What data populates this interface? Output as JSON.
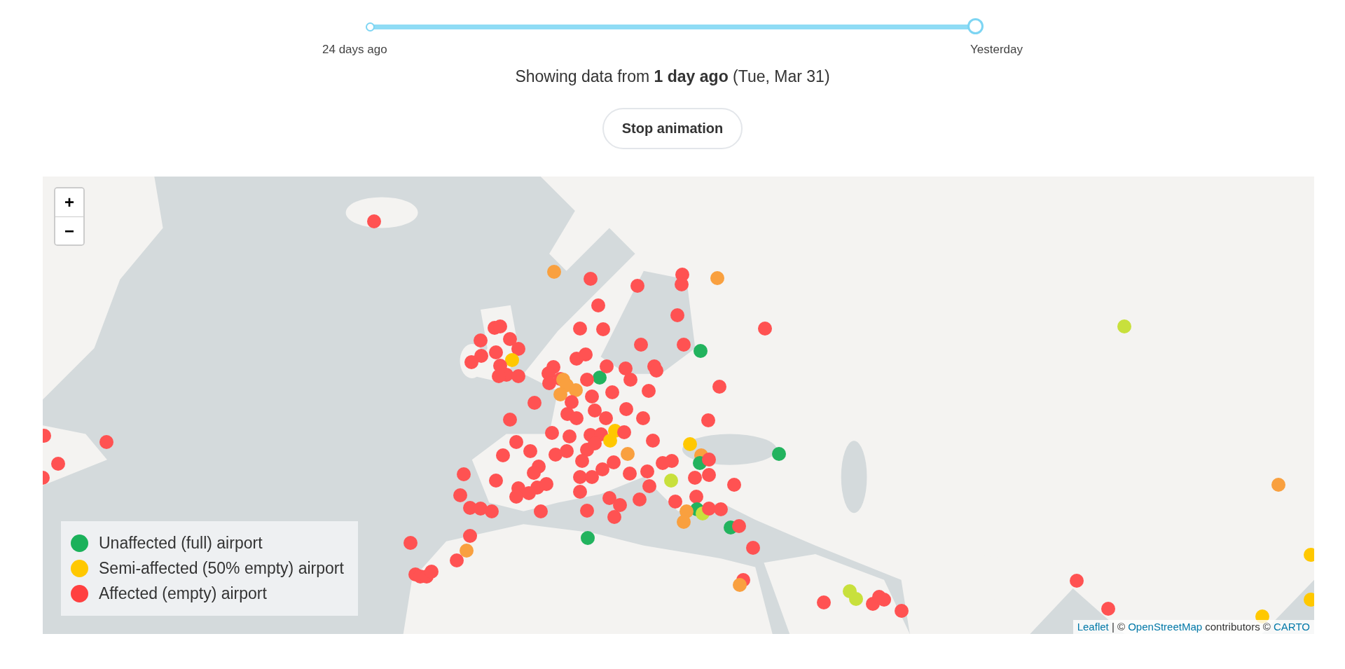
{
  "slider": {
    "start_label": "24 days ago",
    "end_label": "Yesterday",
    "level": 1
  },
  "status": "Showing data from **1 day ago** (Tue, Mar 31)",
  "animation_button": "Stop animation",
  "map": {
    "zoom_in": "+",
    "zoom_out": "−",
    "markers": [
      {
        "color": "#ff5252"
      },
      {
        "color": "#f9a03f"
      },
      {
        "color": "#ff5252"
      },
      {
        "color": "#ff5252"
      },
      {
        "color": "#ff5252"
      },
      {
        "color": "#ff5252"
      },
      {
        "color": "#f9a03f"
      },
      {
        "color": "#ff5252"
      },
      {
        "color": "#ff5252"
      },
      {
        "color": "#ff5252"
      },
      {
        "color": "#c8e03c"
      },
      {
        "color": "#ff5252"
      },
      {
        "color": "#ff5252"
      },
      {
        "color": "#ff5252"
      },
      {
        "color": "#ff5252"
      },
      {
        "color": "#ff5252"
      },
      {
        "color": "#ff5252"
      },
      {
        "color": "#ff5252"
      },
      {
        "color": "#ff5252"
      },
      {
        "color": "#ffc800"
      },
      {
        "color": "#ff5252"
      },
      {
        "color": "#ff5252"
      },
      {
        "color": "#ff5252"
      },
      {
        "color": "#ff5252"
      },
      {
        "color": "#ff5252"
      },
      {
        "color": "#ff5252"
      },
      {
        "color": "#ff5252"
      },
      {
        "color": "#ff5252"
      },
      {
        "color": "#ff5252"
      },
      {
        "color": "#ff5252"
      },
      {
        "color": "#22b35e"
      },
      {
        "color": "#22b35e"
      },
      {
        "color": "#ff5252"
      },
      {
        "color": "#ff5252"
      },
      {
        "color": "#ff5252"
      },
      {
        "color": "#ff5252"
      },
      {
        "color": "#ff5252"
      },
      {
        "color": "#ff5252"
      },
      {
        "color": "#ff5252"
      },
      {
        "color": "#ff5252"
      },
      {
        "color": "#ff5252"
      },
      {
        "color": "#f9a03f"
      },
      {
        "color": "#f9a03f"
      },
      {
        "color": "#ff5252"
      },
      {
        "color": "#f9a03f"
      },
      {
        "color": "#ff5252"
      },
      {
        "color": "#ff5252"
      },
      {
        "color": "#ff5252"
      },
      {
        "color": "#ff5252"
      },
      {
        "color": "#ff5252"
      },
      {
        "color": "#f9a03f"
      },
      {
        "color": "#ff5252"
      },
      {
        "color": "#ff5252"
      },
      {
        "color": "#ff5252"
      },
      {
        "color": "#ff5252"
      },
      {
        "color": "#ff5252"
      },
      {
        "color": "#ff5252"
      },
      {
        "color": "#ff5252"
      },
      {
        "color": "#ff5252"
      },
      {
        "color": "#ff5252"
      },
      {
        "color": "#ffc800"
      },
      {
        "color": "#ff5252"
      },
      {
        "color": "#ff5252"
      },
      {
        "color": "#ff5252"
      },
      {
        "color": "#ff5252"
      },
      {
        "color": "#ff5252"
      },
      {
        "color": "#ff5252"
      },
      {
        "color": "#ffc800"
      },
      {
        "color": "#ff5252"
      },
      {
        "color": "#ff5252"
      },
      {
        "color": "#ff5252"
      },
      {
        "color": "#ff5252"
      },
      {
        "color": "#ff5252"
      },
      {
        "color": "#ff5252"
      },
      {
        "color": "#f9a03f"
      },
      {
        "color": "#ff5252"
      },
      {
        "color": "#ffc800"
      },
      {
        "color": "#f9a03f"
      },
      {
        "color": "#22b35e"
      },
      {
        "color": "#ff5252"
      },
      {
        "color": "#ff5252"
      },
      {
        "color": "#ff5252"
      },
      {
        "color": "#ff5252"
      },
      {
        "color": "#ff5252"
      },
      {
        "color": "#ff5252"
      },
      {
        "color": "#ff5252"
      },
      {
        "color": "#ff5252"
      },
      {
        "color": "#ff5252"
      },
      {
        "color": "#ff5252"
      },
      {
        "color": "#ff5252"
      },
      {
        "color": "#ff5252"
      },
      {
        "color": "#ff5252"
      },
      {
        "color": "#ff5252"
      },
      {
        "color": "#ff5252"
      },
      {
        "color": "#ff5252"
      },
      {
        "color": "#ff5252"
      },
      {
        "color": "#ff5252"
      },
      {
        "color": "#c8e03c"
      },
      {
        "color": "#ff5252"
      },
      {
        "color": "#ff5252"
      },
      {
        "color": "#ff5252"
      },
      {
        "color": "#ff5252"
      },
      {
        "color": "#ff5252"
      },
      {
        "color": "#ff5252"
      },
      {
        "color": "#ff5252"
      },
      {
        "color": "#ff5252"
      },
      {
        "color": "#ff5252"
      },
      {
        "color": "#ff5252"
      },
      {
        "color": "#ff5252"
      },
      {
        "color": "#ff5252"
      },
      {
        "color": "#ff5252"
      },
      {
        "color": "#ff5252"
      },
      {
        "color": "#ff5252"
      },
      {
        "color": "#ff5252"
      },
      {
        "color": "#ff5252"
      },
      {
        "color": "#ff5252"
      },
      {
        "color": "#22b35e"
      },
      {
        "color": "#c8e03c"
      },
      {
        "color": "#f9a03f"
      },
      {
        "color": "#ff5252"
      },
      {
        "color": "#ff5252"
      },
      {
        "color": "#f9a03f"
      },
      {
        "color": "#22b35e"
      },
      {
        "color": "#ff5252"
      },
      {
        "color": "#22b35e"
      },
      {
        "color": "#ff5252"
      },
      {
        "color": "#ff5252"
      },
      {
        "color": "#ff5252"
      },
      {
        "color": "#f9a03f"
      },
      {
        "color": "#ff5252"
      },
      {
        "color": "#ff5252"
      },
      {
        "color": "#ff5252"
      },
      {
        "color": "#ff5252"
      },
      {
        "color": "#ff5252"
      },
      {
        "color": "#ff5252"
      },
      {
        "color": "#f9a03f"
      },
      {
        "color": "#ff5252"
      },
      {
        "color": "#c8e03c"
      },
      {
        "color": "#c8e03c"
      },
      {
        "color": "#ff5252"
      },
      {
        "color": "#ff5252"
      },
      {
        "color": "#ff5252"
      },
      {
        "color": "#ff5252"
      },
      {
        "color": "#ff5252"
      },
      {
        "color": "#ff5252"
      },
      {
        "color": "#f9a03f"
      },
      {
        "color": "#22b35e"
      },
      {
        "color": "#ff5252"
      },
      {
        "color": "#ff5252"
      },
      {
        "color": "#ff5252"
      },
      {
        "color": "#ff5252"
      },
      {
        "color": "#ffc800"
      },
      {
        "color": "#ffc800"
      },
      {
        "color": "#ffc800"
      }
    ],
    "legend": [
      {
        "label": "Unaffected (full) airport",
        "color": "#1ab15a"
      },
      {
        "label": "Semi-affected (50% empty) airport",
        "color": "#ffc800"
      },
      {
        "label": "Affected (empty) airport",
        "color": "#ff4040"
      }
    ],
    "attribution": [
      {
        "kind": "link",
        "text": "Leaflet"
      },
      {
        "kind": "text",
        "text": " | © "
      },
      {
        "kind": "link",
        "text": "OpenStreetMap"
      },
      {
        "kind": "text",
        "text": " contributors © "
      },
      {
        "kind": "link",
        "text": "CARTO"
      }
    ]
  }
}
